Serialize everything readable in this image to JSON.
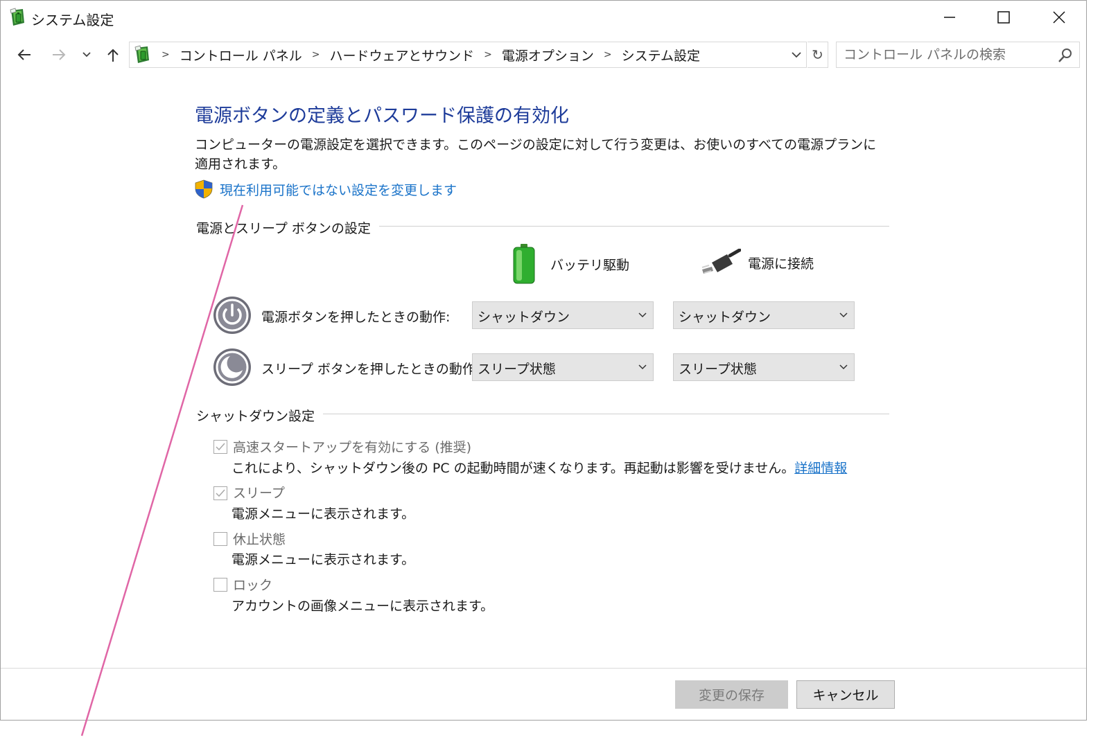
{
  "window": {
    "title": "システム設定",
    "icon": "control-panel-power-icon",
    "controls": [
      "minimize-icon",
      "maximize-icon",
      "close-icon"
    ]
  },
  "address_bar": {
    "breadcrumbs": [
      "コントロール パネル",
      "ハードウェアとサウンド",
      "電源オプション",
      "システム設定"
    ],
    "search_placeholder": "コントロール パネルの検索"
  },
  "page": {
    "heading": "電源ボタンの定義とパスワード保護の有効化",
    "description": "コンピューターの電源設定を選択できます。このページの設定に対して行う変更は、お使いのすべての電源プランに適用されます。",
    "admin_link": "現在利用可能ではない設定を変更します"
  },
  "power_section": {
    "title": "電源とスリープ ボタンの設定",
    "columns": {
      "battery": "バッテリ駆動",
      "plugged": "電源に接続"
    },
    "rows": [
      {
        "label": "電源ボタンを押したときの動作:",
        "battery": "シャットダウン",
        "plugged": "シャットダウン"
      },
      {
        "label": "スリープ ボタンを押したときの動作:",
        "battery": "スリープ状態",
        "plugged": "スリープ状態"
      }
    ]
  },
  "shutdown_section": {
    "title": "シャットダウン設定",
    "options": [
      {
        "label": "高速スタートアップを有効にする (推奨)",
        "description": "これにより、シャットダウン後の PC の起動時間が速くなります。再起動は影響を受けません。",
        "link": "詳細情報",
        "checked": true
      },
      {
        "label": "スリープ",
        "description": "電源メニューに表示されます。",
        "checked": true
      },
      {
        "label": "休止状態",
        "description": "電源メニューに表示されます。",
        "checked": false
      },
      {
        "label": "ロック",
        "description": "アカウントの画像メニューに表示されます。",
        "checked": false
      }
    ]
  },
  "footer": {
    "save": "変更の保存",
    "cancel": "キャンセル"
  },
  "colors": {
    "heading": "#1e3c9a",
    "link": "#1a73c9",
    "annotation_line": "#e066a6"
  }
}
